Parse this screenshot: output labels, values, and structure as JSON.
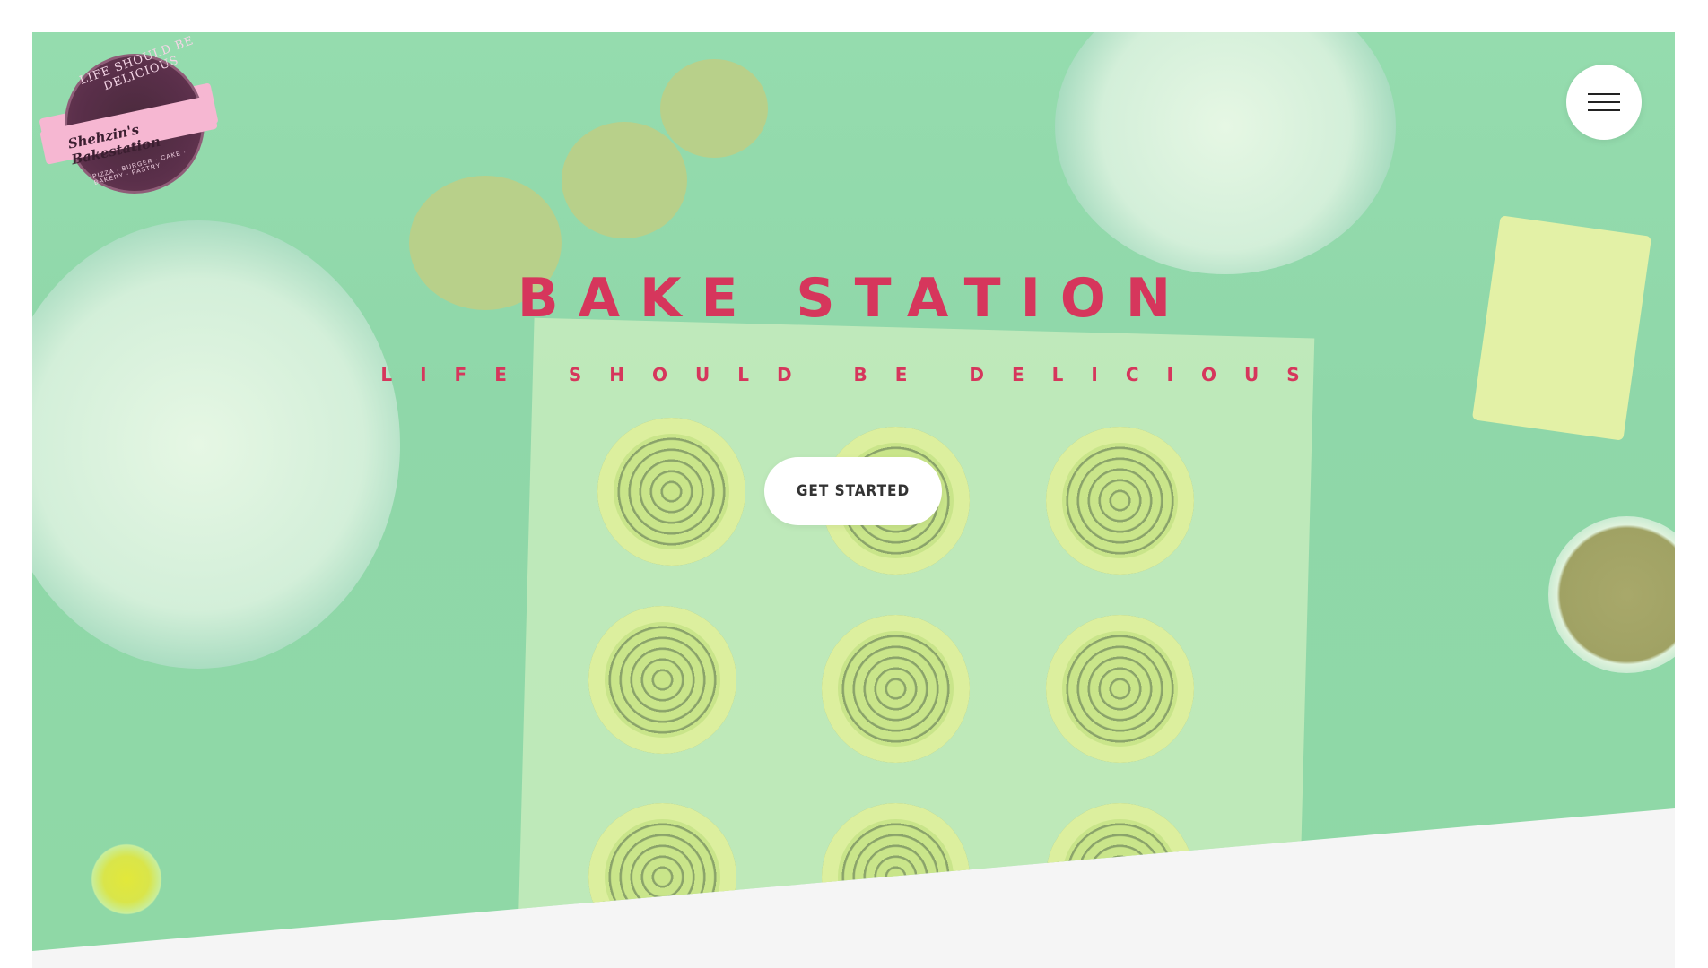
{
  "logo": {
    "arc_text": "LIFE SHOULD BE DELICIOUS",
    "name": "Shehzin's Bakestation",
    "sub_text": "PIZZA · BURGER · CAKE · BAKERY · PASTRY"
  },
  "menu": {
    "icon": "hamburger-menu-icon"
  },
  "hero": {
    "title": "BAKE STATION",
    "subtitle": "LIFE SHOULD BE DELICIOUS",
    "cta_label": "GET STARTED"
  },
  "colors": {
    "accent": "#d6365c",
    "overlay": "#8fd8a6",
    "background": "#f5f5f5"
  }
}
